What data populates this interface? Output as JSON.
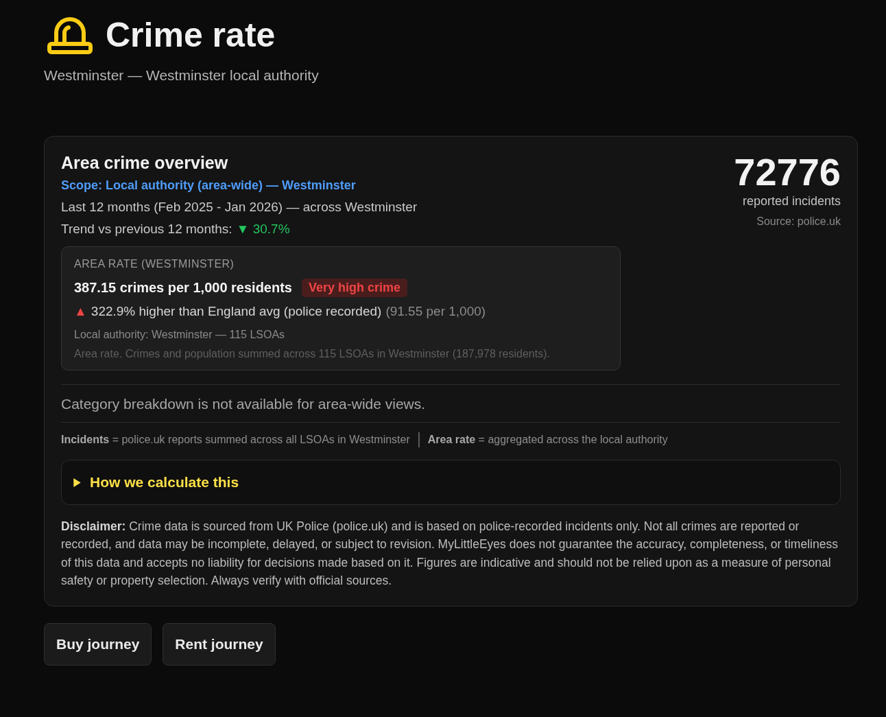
{
  "header": {
    "title": "Crime rate",
    "subtitle": "Westminster — Westminster local authority"
  },
  "overview": {
    "title": "Area crime overview",
    "scope": "Scope: Local authority (area-wide) — Westminster",
    "period": "Last 12 months (Feb 2025 - Jan 2026) — across Westminster",
    "trend_label": "Trend vs previous 12 months:",
    "trend": {
      "arrow": "▼",
      "kind": "decrease",
      "value": "30.7%"
    },
    "incidents": {
      "count": "72776",
      "label": "reported incidents",
      "source": "Source: police.uk"
    },
    "rate_box": {
      "heading": "AREA RATE (WESTMINSTER)",
      "rate": "387.15 crimes per 1,000 residents",
      "badge": {
        "label": "Very high crime",
        "kind": "very_high"
      },
      "comparison": {
        "arrow": "▲",
        "kind": "increase",
        "text": "322.9% higher than England avg (police recorded)",
        "detail": "(91.55 per 1,000)"
      },
      "authority": "Local authority: Westminster — 115 LSOAs",
      "note": "Area rate. Crimes and population summed across 115 LSOAs in Westminster (187,978 residents)."
    },
    "category_note": "Category breakdown is not available for area-wide views.",
    "legend": [
      "**Incidents** = police.uk reports summed across all LSOAs in Westminster",
      "**Area rate** = aggregated across the local authority"
    ],
    "details": {
      "label": "How we calculate this",
      "expanded": false
    },
    "disclaimer": "**Disclaimer:** Crime data is sourced from UK Police (police.uk) and is based on police-recorded incidents only. Not all crimes are reported or recorded, and data may be incomplete, delayed, or subject to revision. MyLittleEyes does not guarantee the accuracy, completeness, or timeliness of this data and accepts no liability for decisions made based on it. Figures are indicative and should not be relied upon as a measure of personal safety or property selection. Always verify with official sources."
  },
  "buttons": [
    "Buy journey",
    "Rent journey"
  ]
}
